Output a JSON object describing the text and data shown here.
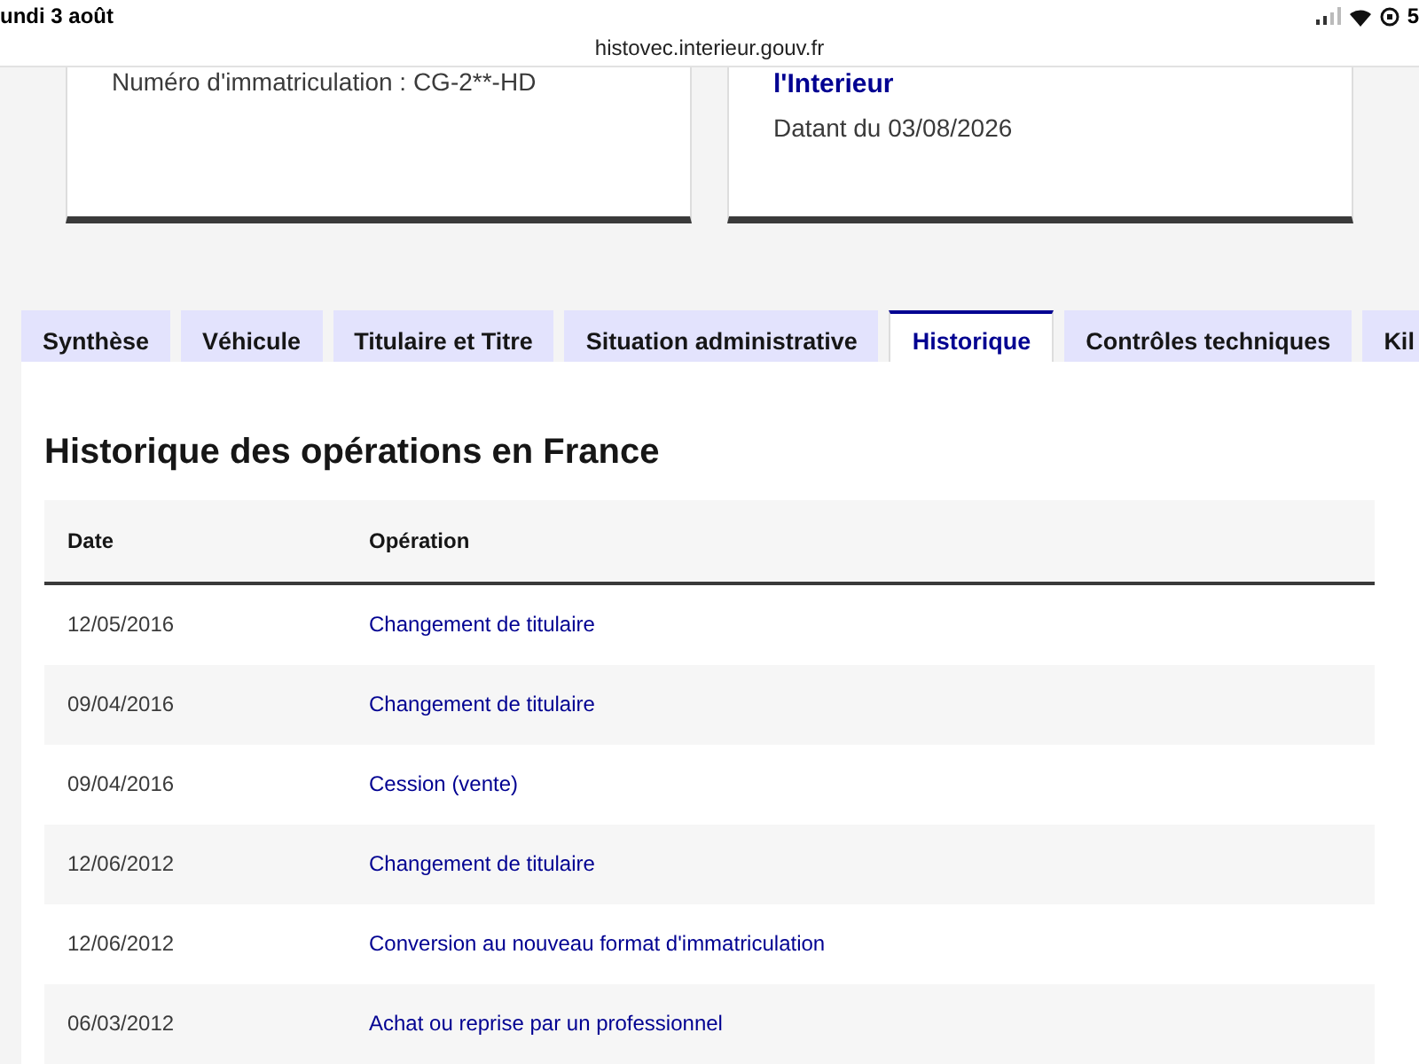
{
  "status_bar": {
    "date": "undi 3 août",
    "battery": "5"
  },
  "address_bar": {
    "url": "histovec.interieur.gouv.fr"
  },
  "cards": [
    {
      "text": "Numéro d'immatriculation : CG-2**-HD"
    },
    {
      "title": "l'Interieur",
      "text": "Datant du 03/08/2026"
    }
  ],
  "tabs": [
    {
      "label": "Synthèse",
      "selected": false
    },
    {
      "label": "Véhicule",
      "selected": false
    },
    {
      "label": "Titulaire et Titre",
      "selected": false
    },
    {
      "label": "Situation administrative",
      "selected": false
    },
    {
      "label": "Historique",
      "selected": true
    },
    {
      "label": "Contrôles techniques",
      "selected": false
    },
    {
      "label": "Kil",
      "selected": false
    }
  ],
  "section": {
    "title": "Historique des opérations en France"
  },
  "table": {
    "columns": [
      "Date",
      "Opération"
    ],
    "rows": [
      [
        "12/05/2016",
        "Changement de titulaire"
      ],
      [
        "09/04/2016",
        "Changement de titulaire"
      ],
      [
        "09/04/2016",
        "Cession (vente)"
      ],
      [
        "12/06/2012",
        "Changement de titulaire"
      ],
      [
        "12/06/2012",
        "Conversion au nouveau format d'immatriculation"
      ],
      [
        "06/03/2012",
        "Achat ou reprise par un professionnel"
      ]
    ]
  }
}
